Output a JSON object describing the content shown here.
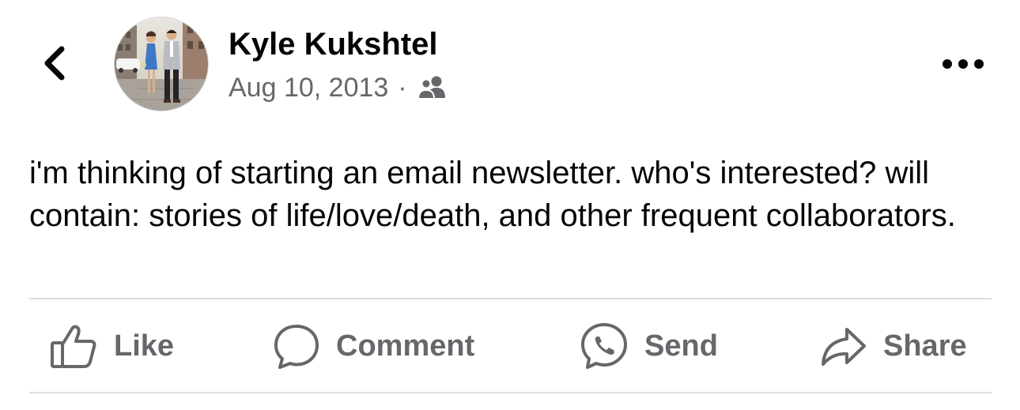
{
  "post": {
    "author": "Kyle Kukshtel",
    "date": "Aug 10, 2013",
    "separator": "·",
    "audience_icon": "friends-icon",
    "text": "i'm thinking of starting an email newsletter. who's interested? will contain: stories of life/love/death, and other frequent collaborators."
  },
  "header": {
    "back_icon": "chevron-left-icon",
    "more_icon": "more-horizontal-icon"
  },
  "actions": [
    {
      "label": "Like",
      "icon": "thumbs-up-icon"
    },
    {
      "label": "Comment",
      "icon": "comment-bubble-icon"
    },
    {
      "label": "Send",
      "icon": "messenger-icon"
    },
    {
      "label": "Share",
      "icon": "share-arrow-icon"
    }
  ],
  "colors": {
    "text_primary": "#050505",
    "text_secondary": "#65676b",
    "divider": "#dadde1"
  }
}
